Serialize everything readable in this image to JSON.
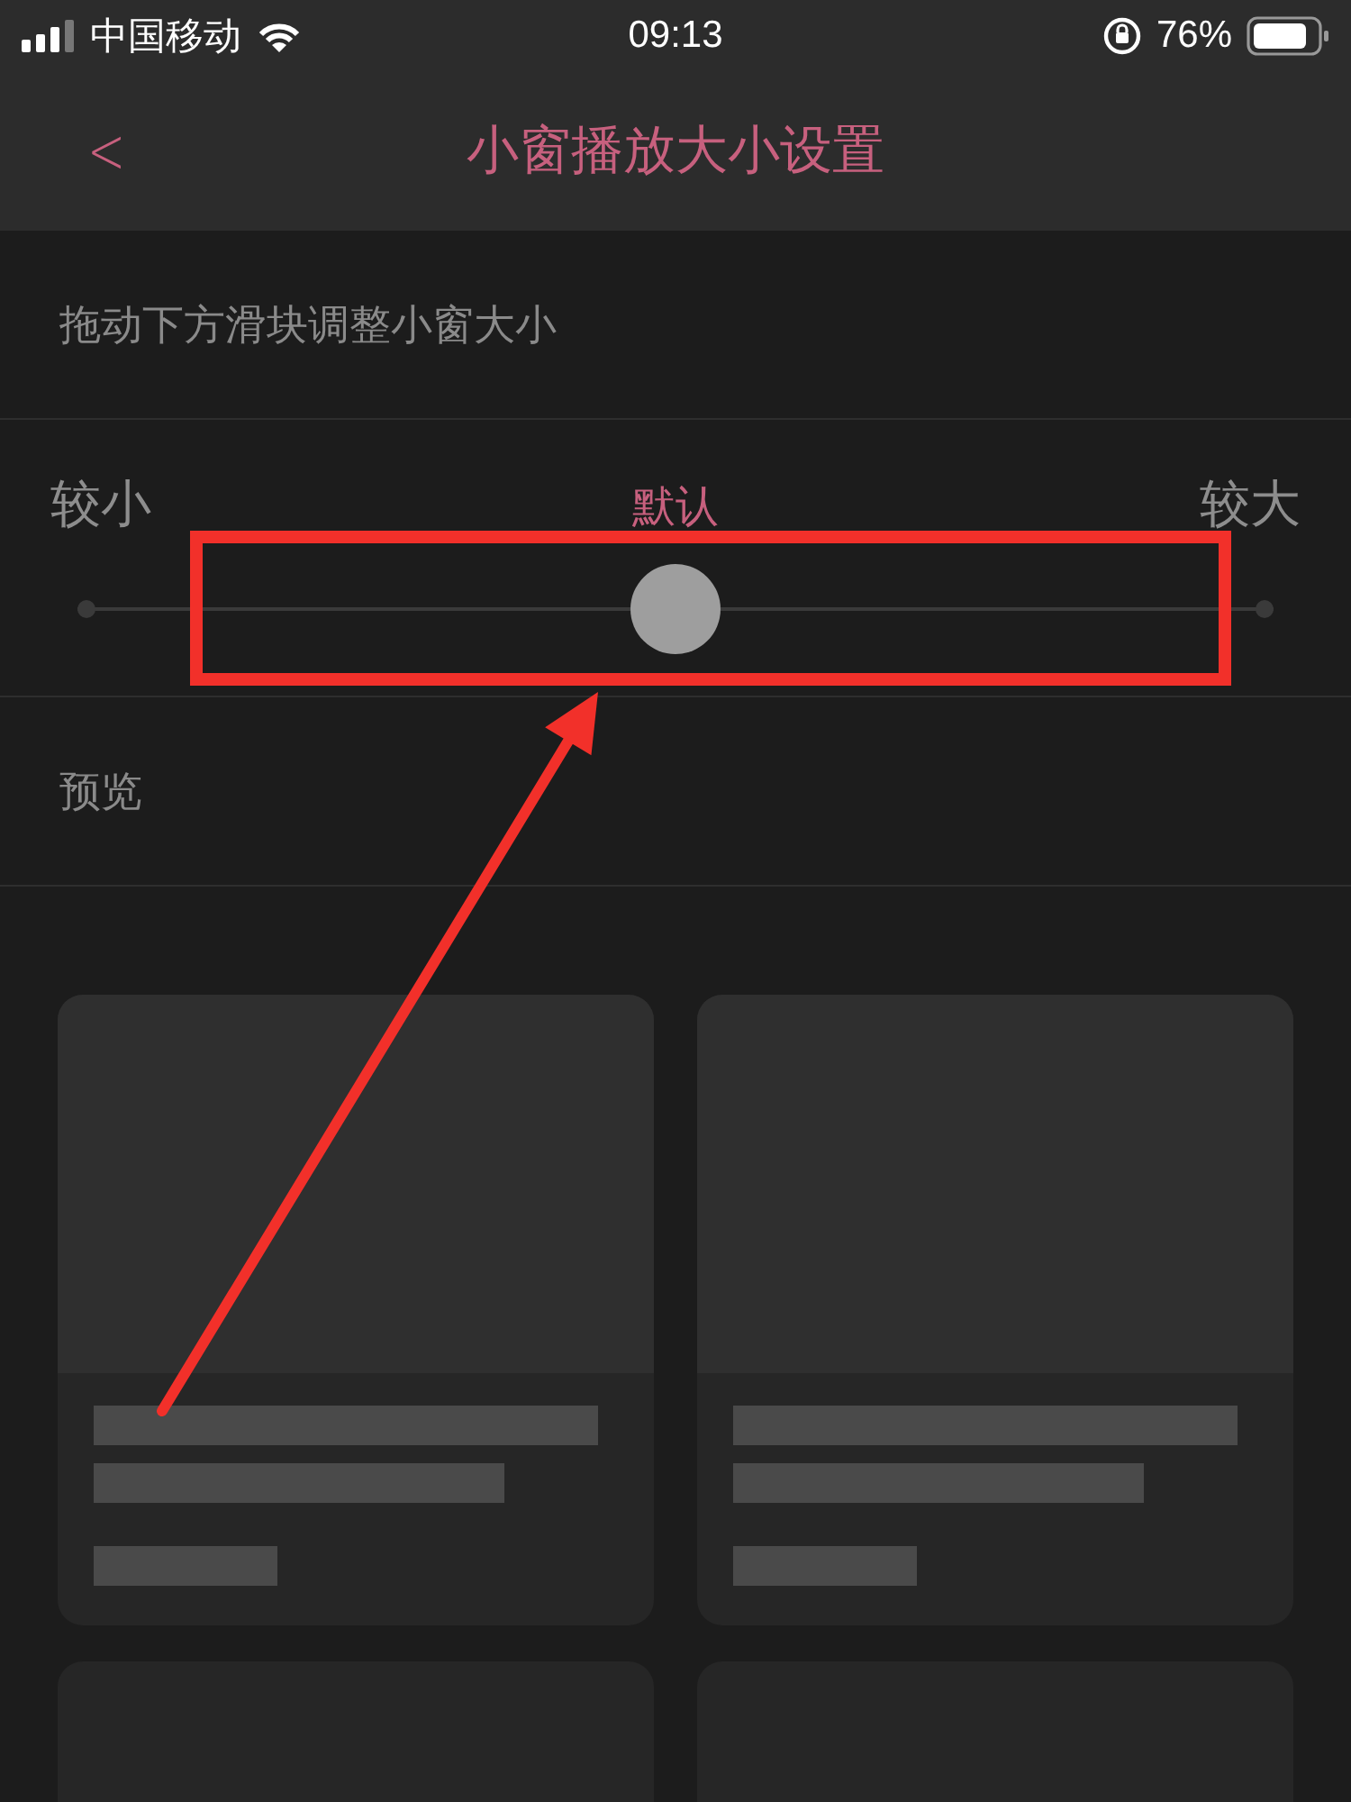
{
  "status_bar": {
    "carrier": "中国移动",
    "time": "09:13",
    "battery": "76%"
  },
  "nav_bar": {
    "back": "<",
    "title": "小窗播放大小设置"
  },
  "hint": "拖动下方滑块调整小窗大小",
  "size_slider": {
    "level": 0.5,
    "labels": [
      {
        "text": "较小",
        "selected": false
      },
      {
        "text": "默认",
        "selected": true
      },
      {
        "text": "较大",
        "selected": false
      }
    ]
  },
  "preview": {
    "title": "预览",
    "cards": [
      {
        "kind": "placeholder"
      },
      {
        "kind": "placeholder"
      },
      {
        "kind": "cut"
      },
      {
        "kind": "cut"
      }
    ]
  },
  "annotations": [
    {
      "kind": "box"
    },
    {
      "kind": "arrow"
    }
  ]
}
